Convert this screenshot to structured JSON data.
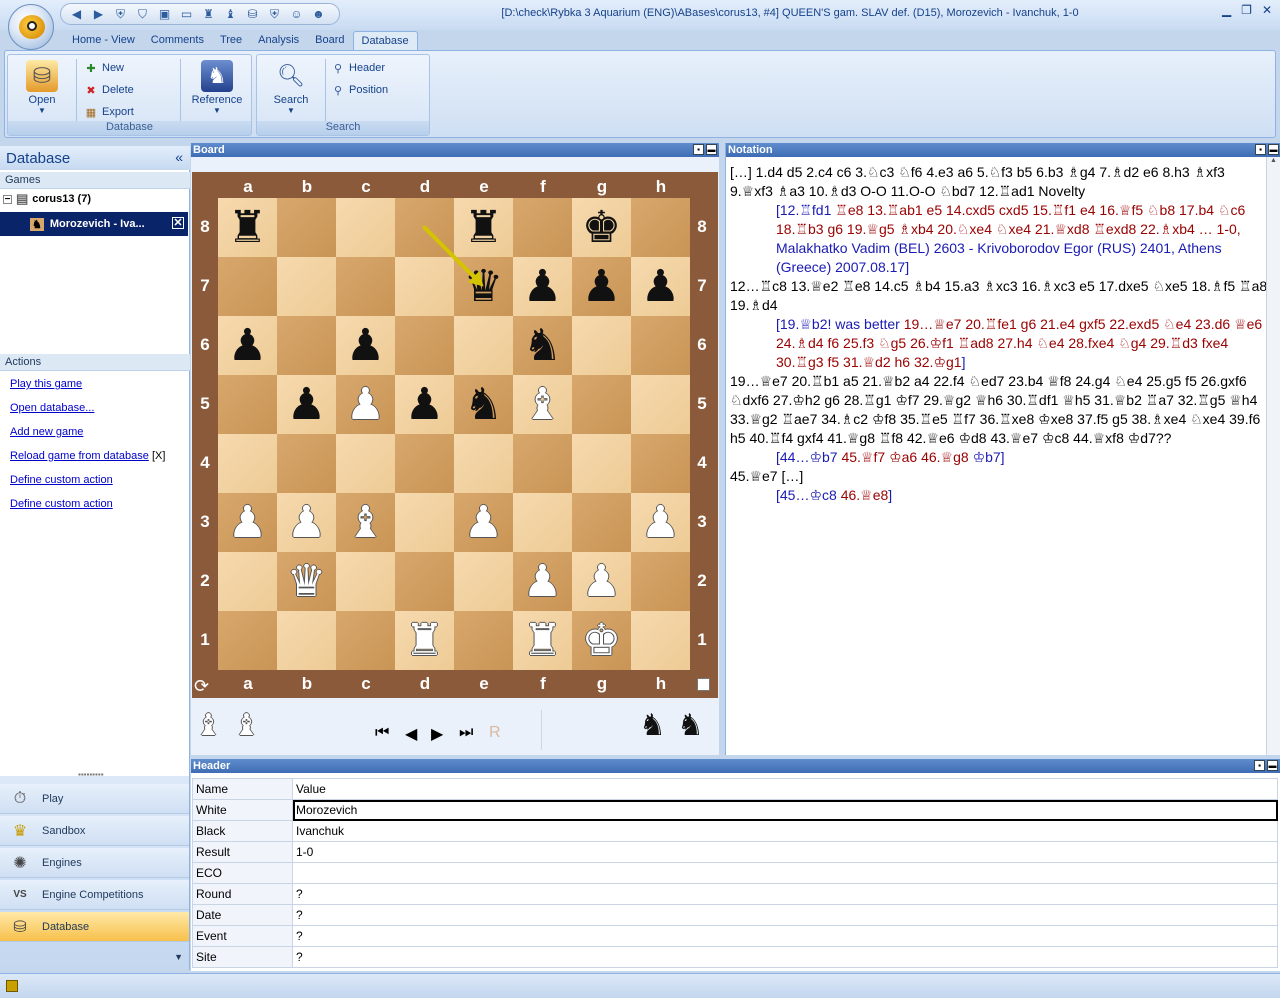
{
  "window": {
    "title": "[D:\\check\\Rybka 3 Aquarium (ENG)\\ABases\\corus13, #4] QUEEN'S gam. SLAV def. (D15), Morozevich - Ivanchuk, 1-0"
  },
  "ribbon": {
    "tabs": [
      "Home - View",
      "Comments",
      "Tree",
      "Analysis",
      "Board",
      "Database"
    ],
    "active_tab": "Database",
    "database_group": {
      "label": "Database",
      "open": "Open",
      "new": "New",
      "delete": "Delete",
      "export": "Export",
      "reference": "Reference"
    },
    "search_group": {
      "label": "Search",
      "search": "Search",
      "header": "Header",
      "position": "Position"
    }
  },
  "left_panel": {
    "title": "Database",
    "games_label": "Games",
    "database_name": "corus13 (7)",
    "selected_game": "Morozevich - Iva...",
    "actions_label": "Actions",
    "actions": [
      "Play this game",
      "Open database...",
      "Add new game",
      "Reload game from database",
      "Define custom action",
      "Define custom action"
    ],
    "reload_badge": "[X]"
  },
  "nav": {
    "items": [
      "Play",
      "Sandbox",
      "Engines",
      "Engine Competitions",
      "Database"
    ],
    "active": "Database",
    "engine_competitions_badge": "VS"
  },
  "board": {
    "panel_title": "Board",
    "files": [
      "a",
      "b",
      "c",
      "d",
      "e",
      "f",
      "g",
      "h"
    ],
    "ranks": [
      "8",
      "7",
      "6",
      "5",
      "4",
      "3",
      "2",
      "1"
    ],
    "position": [
      [
        "br",
        "",
        "",
        "",
        "br",
        "",
        "bk",
        ""
      ],
      [
        "",
        "",
        "",
        "",
        "bq",
        "bp",
        "bp",
        "bp"
      ],
      [
        "bp",
        "",
        "bp",
        "",
        "",
        "bn",
        "",
        ""
      ],
      [
        "",
        "bp",
        "wp",
        "bp",
        "bn",
        "wb",
        "",
        ""
      ],
      [
        "",
        "",
        "",
        "",
        "",
        "",
        "",
        ""
      ],
      [
        "wp",
        "wp",
        "wb",
        "",
        "wp",
        "",
        "",
        "wp"
      ],
      [
        "",
        "wq",
        "",
        "",
        "",
        "wp",
        "wp",
        ""
      ],
      [
        "",
        "",
        "",
        "wr",
        "",
        "wr",
        "wk",
        ""
      ]
    ],
    "arrow": {
      "from": "d8",
      "to": "e7",
      "color": "#d4c400"
    },
    "captured_white": [
      "wb",
      "wb"
    ],
    "captured_black": [
      "bn",
      "bn"
    ],
    "light_square": "#f1d3a2",
    "dark_square": "#d09e60"
  },
  "notation": {
    "panel_title": "Notation",
    "lines": [
      {
        "type": "main",
        "text": "[…] 1.d4 d5 2.c4 c6 3.♘c3 ♘f6 4.e3 a6 5.♘f3 b5 6.b3 ♗g4 7.♗d2 e6 8.h3 ♗xf3 9.♕xf3 ♗a3 10.♗d3 O-O 11.O-O ♘bd7 12.♖ad1 Novelty"
      },
      {
        "type": "var",
        "parts": [
          {
            "c": "v1",
            "t": "[12.♖fd1 "
          },
          {
            "c": "v2",
            "t": "♖e8 13.♖ab1 e5 14.cxd5 cxd5 15.♖f1 e4 16.♕f5 ♘b8 17.b4 ♘c6 18.♖b3 g6 19.♕g5 ♗xb4 20.♘xe4 ♘xe4 21.♕xd8 ♖exd8 22.♗xb4 … 1-0, "
          },
          {
            "c": "v1",
            "t": "Malakhatko Vadim (BEL) 2603 - Krivoborodov Egor (RUS) 2401, Athens (Greece) 2007.08.17]"
          }
        ]
      },
      {
        "type": "main",
        "text": "12…♖c8 13.♕e2 ♖e8 14.c5 ♗b4 15.a3 ♗xc3 16.♗xc3 e5 17.dxe5 ♘xe5 18.♗f5 ♖a8 19.♗d4"
      },
      {
        "type": "var",
        "parts": [
          {
            "c": "v1",
            "t": "[19.♕b2! was better "
          },
          {
            "c": "v2",
            "t": "19…♕e7 20.♖fe1 g6 21.e4 gxf5 22.exd5 ♘e4 23.d6 ♕e6 24.♗d4 f6 25.f3 ♘g5 26.♔f1 ♖ad8 27.h4 ♘e4 28.fxe4 ♘g4 29.♖d3 fxe4 30.♖g3 f5 31.♕d2 h6 32.♔g1"
          },
          {
            "c": "v1",
            "t": "]"
          }
        ]
      },
      {
        "type": "main",
        "text": "19…♕e7 20.♖b1 a5 21.♕b2 a4 22.f4 ♘ed7 23.b4 ♕f8 24.g4 ♘e4 25.g5 f5 26.gxf6 ♘dxf6 27.♔h2 g6 28.♖g1 ♔f7 29.♕g2 ♕h6 30.♖df1 ♕h5 31.♕b2 ♖a7 32.♖g5 ♕h4 33.♕g2 ♖ae7 34.♗c2 ♔f8 35.♖e5 ♖f7 36.♖xe8 ♔xe8 37.f5 g5 38.♗xe4 ♘xe4 39.f6 h5 40.♖f4 gxf4 41.♕g8 ♖f8 42.♕e6 ♔d8 43.♕e7 ♔c8 44.♕xf8 ♔d7??"
      },
      {
        "type": "var",
        "parts": [
          {
            "c": "v1",
            "t": "[44…♔b7 "
          },
          {
            "c": "v2",
            "t": "45.♕f7 ♔a6 46.♕g8 "
          },
          {
            "c": "v1",
            "t": "♔b7]"
          }
        ]
      },
      {
        "type": "main",
        "text": "45.♕e7 […]"
      },
      {
        "type": "var",
        "parts": [
          {
            "c": "v1",
            "t": "[45…♔c8 "
          },
          {
            "c": "v2",
            "t": "46.♕e8"
          },
          {
            "c": "v1",
            "t": "]"
          }
        ]
      }
    ]
  },
  "header": {
    "panel_title": "Header",
    "col_name": "Name",
    "col_value": "Value",
    "rows": [
      {
        "name": "White",
        "value": "Morozevich"
      },
      {
        "name": "Black",
        "value": "Ivanchuk"
      },
      {
        "name": "Result",
        "value": "1-0"
      },
      {
        "name": "ECO",
        "value": ""
      },
      {
        "name": "Round",
        "value": "?"
      },
      {
        "name": "Date",
        "value": "?"
      },
      {
        "name": "Event",
        "value": "?"
      },
      {
        "name": "Site",
        "value": "?"
      }
    ],
    "selected_row": "White"
  },
  "icons": {
    "back": "arrow-left-icon",
    "forward": "arrow-right-icon",
    "first": "first-move-icon",
    "prev": "prev-move-icon",
    "next": "next-move-icon",
    "last": "last-move-icon",
    "rotate": "rotate-board-icon",
    "side": "side-to-move-icon",
    "r": "R"
  },
  "colors": {
    "accent": "#15428b",
    "variation_blue": "#1a1ab4",
    "variation_red": "#9a0000",
    "active_nav": "#f7c04b"
  }
}
